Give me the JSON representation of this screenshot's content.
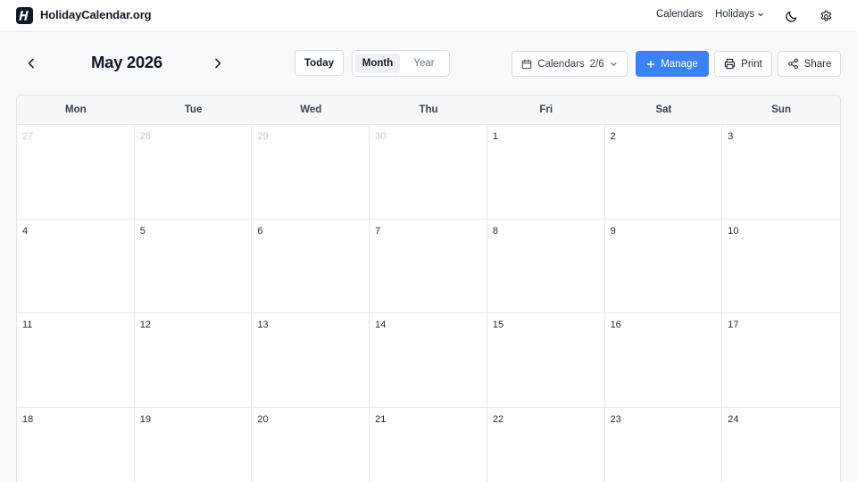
{
  "header": {
    "brand": "HolidayCalendar.org",
    "logo_letter": "H",
    "nav": {
      "calendars": "Calendars",
      "holidays": "Holidays"
    },
    "icons": [
      "moon-icon",
      "gear-icon",
      "chevron-down-icon"
    ]
  },
  "toolbar": {
    "title": "May 2026",
    "today": "Today",
    "views": [
      "Month",
      "Year"
    ],
    "active_view": "Month",
    "calendars_label": "Calendars",
    "calendars_count": "2/6",
    "manage": "Manage",
    "print": "Print",
    "share": "Share"
  },
  "colors": {
    "accent": "#3b82f6",
    "text": "#111827",
    "muted_day": "#c3c8d0"
  },
  "calendar": {
    "weekdays": [
      "Mon",
      "Tue",
      "Wed",
      "Thu",
      "Fri",
      "Sat",
      "Sun"
    ],
    "weeks": [
      [
        {
          "d": "27",
          "other": true
        },
        {
          "d": "28",
          "other": true
        },
        {
          "d": "29",
          "other": true
        },
        {
          "d": "30",
          "other": true
        },
        {
          "d": "1",
          "other": false
        },
        {
          "d": "2",
          "other": false
        },
        {
          "d": "3",
          "other": false
        }
      ],
      [
        {
          "d": "4",
          "other": false
        },
        {
          "d": "5",
          "other": false
        },
        {
          "d": "6",
          "other": false
        },
        {
          "d": "7",
          "other": false
        },
        {
          "d": "8",
          "other": false
        },
        {
          "d": "9",
          "other": false
        },
        {
          "d": "10",
          "other": false
        }
      ],
      [
        {
          "d": "11",
          "other": false
        },
        {
          "d": "12",
          "other": false
        },
        {
          "d": "13",
          "other": false
        },
        {
          "d": "14",
          "other": false
        },
        {
          "d": "15",
          "other": false
        },
        {
          "d": "16",
          "other": false
        },
        {
          "d": "17",
          "other": false
        }
      ],
      [
        {
          "d": "18",
          "other": false
        },
        {
          "d": "19",
          "other": false
        },
        {
          "d": "20",
          "other": false
        },
        {
          "d": "21",
          "other": false
        },
        {
          "d": "22",
          "other": false
        },
        {
          "d": "23",
          "other": false
        },
        {
          "d": "24",
          "other": false
        }
      ]
    ]
  }
}
